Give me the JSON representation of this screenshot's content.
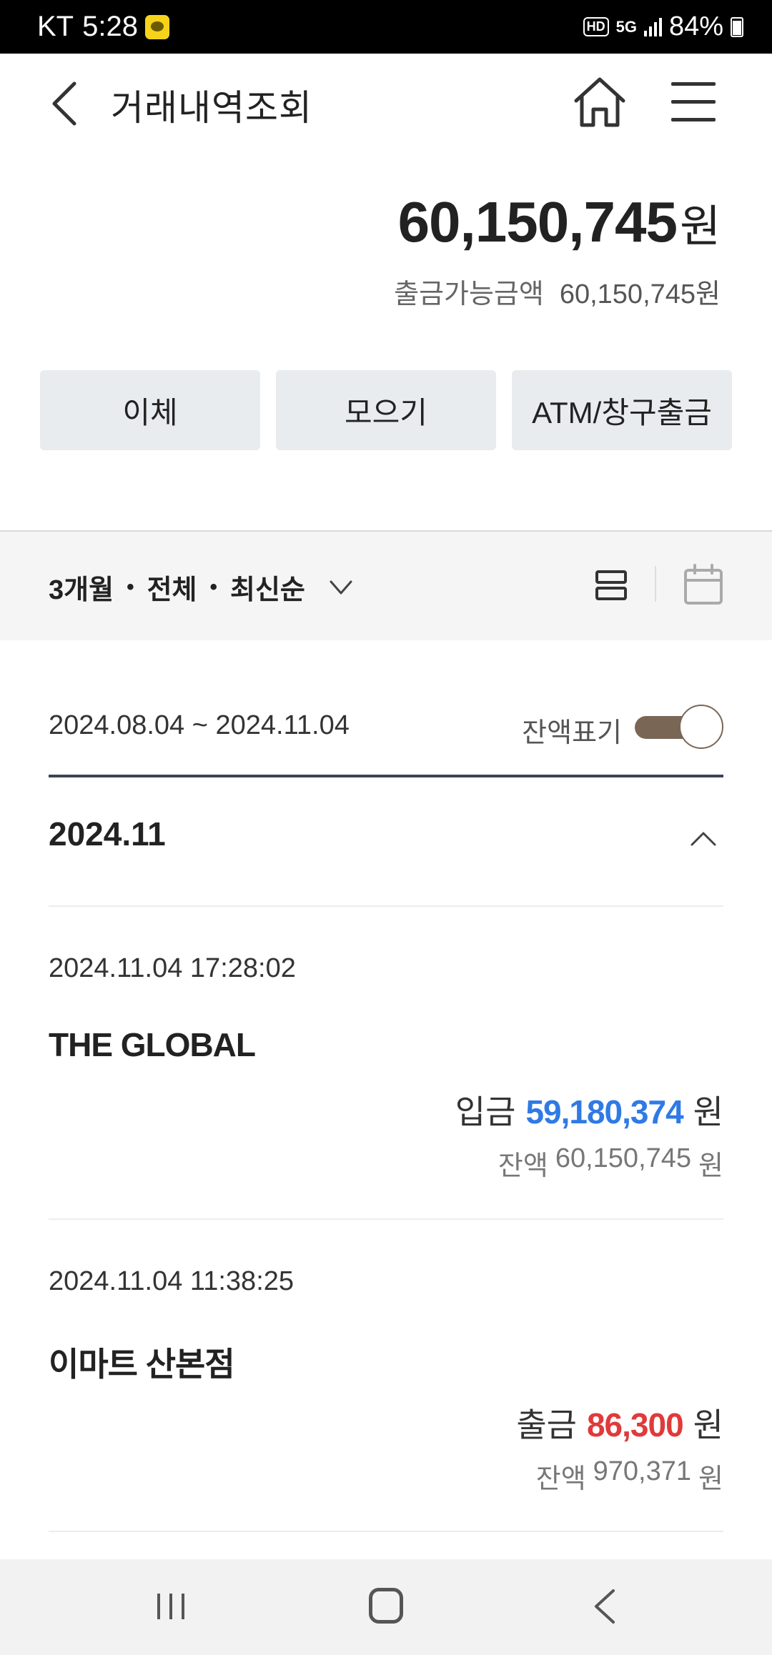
{
  "status_bar": {
    "carrier": "KT",
    "time": "5:28",
    "network_hd": "HD",
    "network_5g": "5G",
    "battery": "84%"
  },
  "header": {
    "title": "거래내역조회"
  },
  "account": {
    "balance_amount": "60,150,745",
    "balance_unit": "원",
    "available_label": "출금가능금액",
    "available_value": "60,150,745원"
  },
  "actions": [
    {
      "label": "이체"
    },
    {
      "label": "모으기"
    },
    {
      "label": "ATM/창구출금"
    }
  ],
  "filter": {
    "period": "3개월",
    "type": "전체",
    "sort": "최신순",
    "separator": "•"
  },
  "range": {
    "text": "2024.08.04 ~ 2024.11.04",
    "balance_toggle_label": "잔액표기",
    "balance_toggle_on": true
  },
  "month_group": {
    "label": "2024.11"
  },
  "transactions": [
    {
      "timestamp": "2024.11.04 17:28:02",
      "name": "THE GLOBAL",
      "kind": "입금",
      "amount": "59,180,374",
      "unit": "원",
      "balance_label": "잔액",
      "balance": "60,150,745",
      "balance_unit": "원",
      "amount_color": "#2f7ae5"
    },
    {
      "timestamp": "2024.11.04 11:38:25",
      "name": "이마트 산본점",
      "kind": "출금",
      "amount": "86,300",
      "unit": "원",
      "balance_label": "잔액",
      "balance": "970,371",
      "balance_unit": "원",
      "amount_color": "#e03a3a"
    }
  ],
  "colors": {
    "deposit": "#2f7ae5",
    "withdrawal": "#e03a3a",
    "toggle_track": "#7a6654",
    "button_bg": "#e9ecef"
  }
}
